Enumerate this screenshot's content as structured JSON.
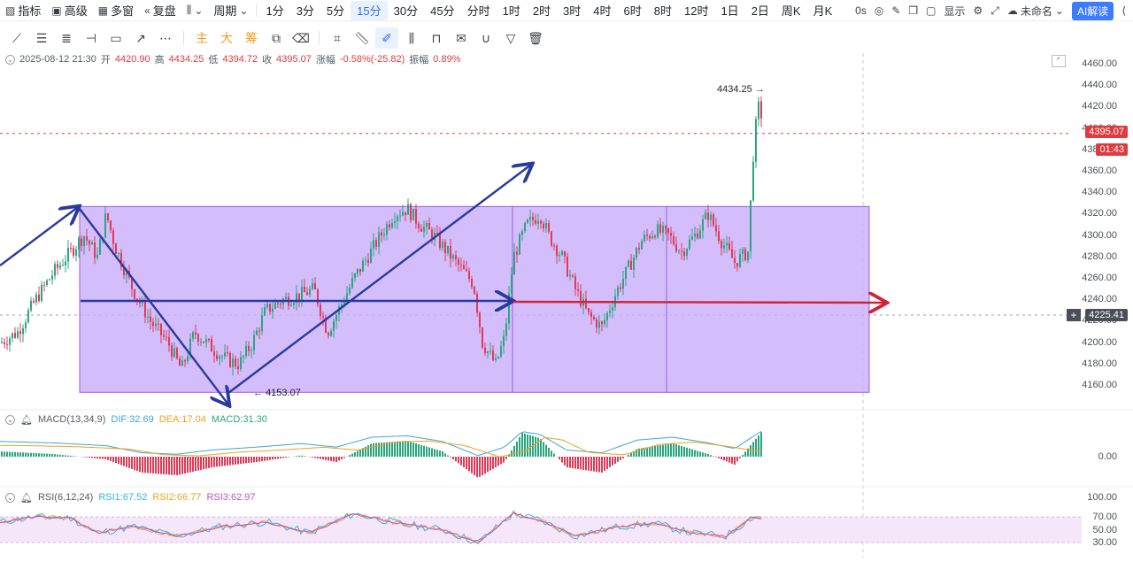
{
  "toolbar": {
    "indicators": "指标",
    "advanced": "高级",
    "multi_window": "多窗",
    "replay": "复盘",
    "period": "周期",
    "periods": [
      "1分",
      "3分",
      "5分",
      "15分",
      "30分",
      "45分",
      "分时",
      "1时",
      "2时",
      "3时",
      "4时",
      "6时",
      "8时",
      "12时",
      "1日",
      "2日",
      "周K",
      "月K"
    ],
    "active_period": "15分",
    "right": {
      "latency": "0s",
      "display": "显示",
      "file_name": "未命名",
      "ai_label": "AI解读"
    }
  },
  "drawbar": {
    "main_label": "主",
    "big_label": "大",
    "chip_label": "筹"
  },
  "ohlc": {
    "datetime": "2025-08-12 21:30",
    "open_label": "开",
    "open": "4420.90",
    "high_label": "高",
    "high": "4434.25",
    "low_label": "低",
    "low": "4394.72",
    "close_label": "收",
    "close": "4395.07",
    "change_label": "涨幅",
    "change": "-0.58%(-25.82)",
    "amp_label": "振幅",
    "amp": "0.89%"
  },
  "price_axis": {
    "ticks": [
      "4460.00",
      "4440.00",
      "4420.00",
      "4400.00",
      "4380.00",
      "4360.00",
      "4340.00",
      "4320.00",
      "4300.00",
      "4280.00",
      "4260.00",
      "4240.00",
      "4220.00",
      "4200.00",
      "4180.00",
      "4160.00"
    ],
    "last_price": "4395.07",
    "countdown": "01:43",
    "crosshair_price": "4225.41"
  },
  "annotations": {
    "high_marker": "4434.25",
    "low_marker": "4153.07"
  },
  "macd": {
    "name": "MACD(13,34,9)",
    "dif_label": "DIF:32.69",
    "dea_label": "DEA:17.04",
    "macd_label": "MACD:31.30",
    "zero_tick": "0.00"
  },
  "rsi": {
    "name": "RSI(6,12,24)",
    "rsi1_label": "RSI1:67.52",
    "rsi2_label": "RSI2:66.77",
    "rsi3_label": "RSI3:62.97",
    "ticks": [
      "100.00",
      "70.00",
      "50.00",
      "30.00"
    ]
  },
  "colors": {
    "up": "#2ba580",
    "down": "#e03a58",
    "box_fill": "#cdb2fa",
    "box_stroke": "#9b5de5",
    "arrow_blue": "#283a9c",
    "arrow_red": "#d0233a",
    "accent": "#2f6bff",
    "dif": "#3aa7d8",
    "dea": "#f0a020",
    "rsi1": "#33b5d9",
    "rsi2": "#f0a020",
    "rsi3": "#c050c8"
  },
  "chart_data": {
    "type": "candlestick",
    "title": "",
    "price_range": [
      4150,
      4465
    ],
    "close_path": [
      [
        0,
        4200
      ],
      [
        20,
        4210
      ],
      [
        40,
        4240
      ],
      [
        60,
        4265
      ],
      [
        80,
        4285
      ],
      [
        95,
        4300
      ],
      [
        110,
        4280
      ],
      [
        120,
        4320
      ],
      [
        130,
        4290
      ],
      [
        150,
        4250
      ],
      [
        170,
        4220
      ],
      [
        190,
        4200
      ],
      [
        205,
        4175
      ],
      [
        220,
        4210
      ],
      [
        240,
        4195
      ],
      [
        255,
        4185
      ],
      [
        270,
        4180
      ],
      [
        285,
        4200
      ],
      [
        300,
        4230
      ],
      [
        320,
        4240
      ],
      [
        340,
        4245
      ],
      [
        355,
        4250
      ],
      [
        370,
        4210
      ],
      [
        385,
        4235
      ],
      [
        400,
        4260
      ],
      [
        415,
        4280
      ],
      [
        430,
        4300
      ],
      [
        445,
        4320
      ],
      [
        460,
        4325
      ],
      [
        475,
        4310
      ],
      [
        490,
        4300
      ],
      [
        505,
        4285
      ],
      [
        520,
        4270
      ],
      [
        535,
        4255
      ],
      [
        545,
        4200
      ],
      [
        560,
        4180
      ],
      [
        570,
        4205
      ],
      [
        580,
        4280
      ],
      [
        595,
        4310
      ],
      [
        610,
        4320
      ],
      [
        620,
        4300
      ],
      [
        635,
        4280
      ],
      [
        650,
        4250
      ],
      [
        665,
        4225
      ],
      [
        680,
        4215
      ],
      [
        695,
        4245
      ],
      [
        710,
        4270
      ],
      [
        725,
        4295
      ],
      [
        740,
        4305
      ],
      [
        755,
        4300
      ],
      [
        770,
        4285
      ],
      [
        785,
        4300
      ],
      [
        800,
        4320
      ],
      [
        815,
        4295
      ],
      [
        830,
        4275
      ],
      [
        845,
        4285
      ],
      [
        852,
        4390
      ],
      [
        858,
        4425
      ],
      [
        862,
        4400
      ]
    ],
    "macd_shape": [
      [
        0,
        0.2
      ],
      [
        60,
        0.1
      ],
      [
        120,
        -0.1
      ],
      [
        160,
        -0.6
      ],
      [
        200,
        -0.7
      ],
      [
        240,
        -0.4
      ],
      [
        290,
        -0.2
      ],
      [
        340,
        0.05
      ],
      [
        380,
        -0.2
      ],
      [
        420,
        0.5
      ],
      [
        460,
        0.6
      ],
      [
        500,
        0.2
      ],
      [
        540,
        -0.8
      ],
      [
        570,
        -0.2
      ],
      [
        590,
        0.9
      ],
      [
        610,
        0.7
      ],
      [
        640,
        -0.4
      ],
      [
        680,
        -0.6
      ],
      [
        720,
        0.3
      ],
      [
        760,
        0.5
      ],
      [
        800,
        0.1
      ],
      [
        830,
        -0.3
      ],
      [
        862,
        1.0
      ]
    ],
    "rsi_shape": [
      [
        0,
        62
      ],
      [
        40,
        70
      ],
      [
        80,
        68
      ],
      [
        110,
        45
      ],
      [
        150,
        55
      ],
      [
        200,
        40
      ],
      [
        250,
        55
      ],
      [
        300,
        62
      ],
      [
        350,
        45
      ],
      [
        400,
        75
      ],
      [
        450,
        60
      ],
      [
        500,
        50
      ],
      [
        540,
        30
      ],
      [
        580,
        75
      ],
      [
        610,
        65
      ],
      [
        650,
        40
      ],
      [
        700,
        55
      ],
      [
        740,
        60
      ],
      [
        780,
        45
      ],
      [
        820,
        40
      ],
      [
        850,
        70
      ],
      [
        862,
        67
      ]
    ]
  }
}
